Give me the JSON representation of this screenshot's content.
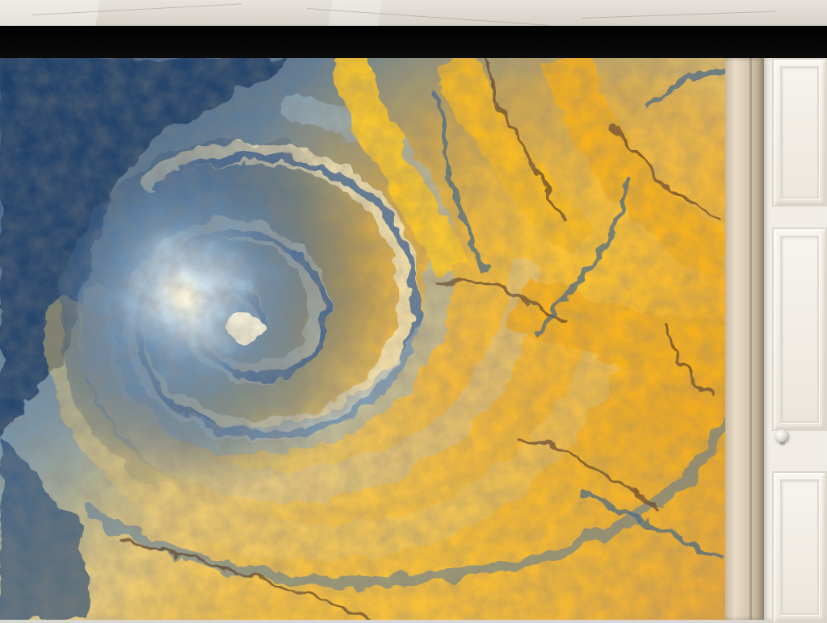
{
  "scene": {
    "colors": {
      "wall_marble": "#e2ded6",
      "frame_black": "#000000",
      "swirl_blue_dark": "#1f3d66",
      "swirl_blue": "#4f7fae",
      "swirl_steel": "#8fb0c7",
      "swirl_cream": "#f2dfa8",
      "swirl_gold": "#f4b21e",
      "swirl_amber": "#e39a16",
      "swirl_brown": "#6b4a2c",
      "door_white": "#f1ede6",
      "door_frame_wood": "#d7c8b0"
    }
  }
}
